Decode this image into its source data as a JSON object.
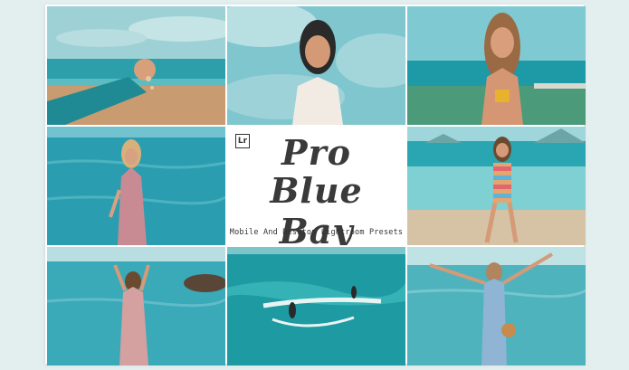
{
  "badge": "Lr",
  "title_line1": "Pro",
  "title_line2": "Blue Bay",
  "subtitle": "Mobile And Desktop Lightroom Presets",
  "colors": {
    "sky": "#8ccfd6",
    "sea": "#2aa7b1",
    "deep_sea": "#1c8f9c",
    "sand": "#c79a6f",
    "text": "#3a3a3a"
  },
  "photos": [
    {
      "name": "photo-hand-sand-beach"
    },
    {
      "name": "photo-woman-portrait-clouds"
    },
    {
      "name": "photo-woman-smiling-shore"
    },
    {
      "name": "photo-woman-pink-dress-sea"
    },
    {
      "name": "photo-woman-striped-swimsuit"
    },
    {
      "name": "photo-woman-arms-up-rock"
    },
    {
      "name": "photo-surfers-waves"
    },
    {
      "name": "photo-woman-arms-spread-sea"
    }
  ]
}
